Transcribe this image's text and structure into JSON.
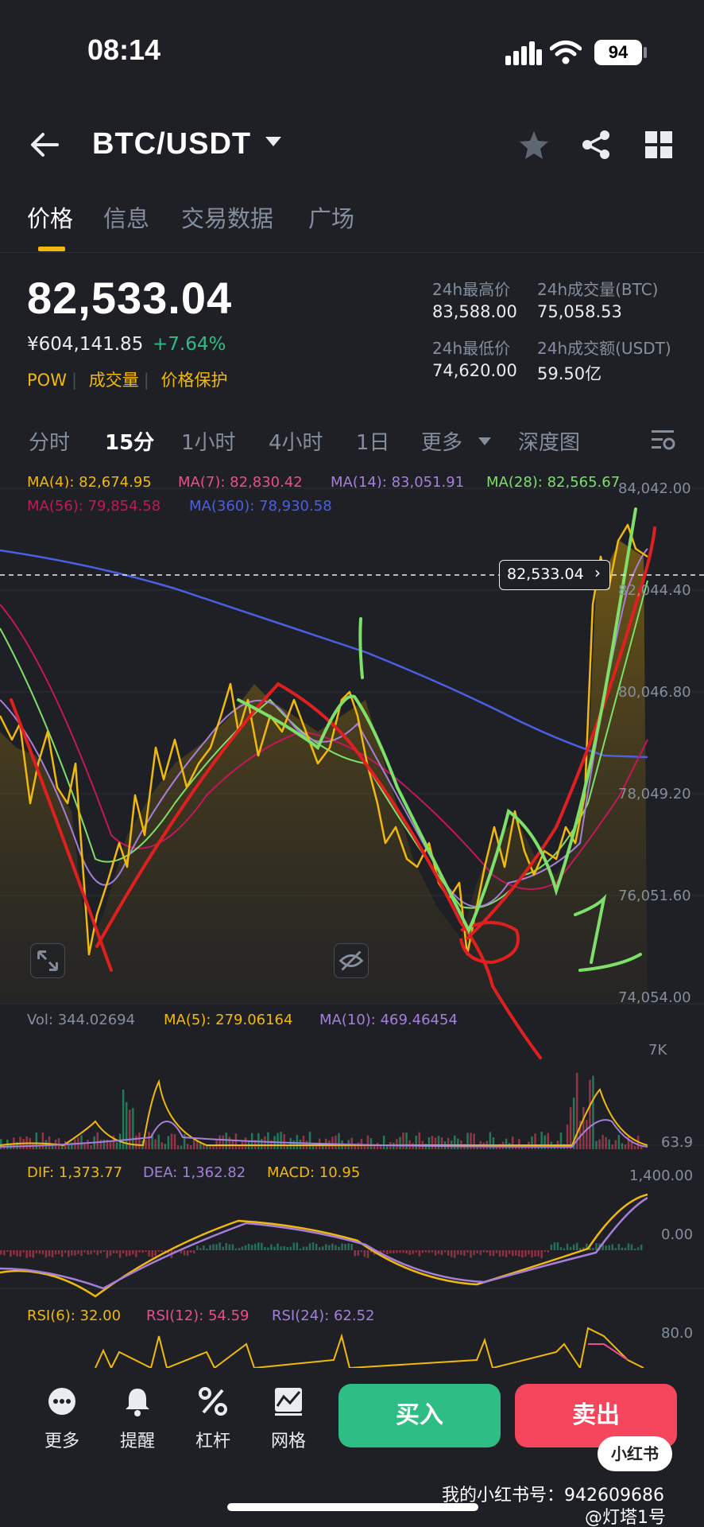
{
  "status_bar": {
    "time": "08:14",
    "battery": "94"
  },
  "header": {
    "pair": "BTC/USDT"
  },
  "tabs": [
    {
      "label": "价格",
      "active": true
    },
    {
      "label": "信息"
    },
    {
      "label": "交易数据"
    },
    {
      "label": "广场"
    }
  ],
  "ticker": {
    "price": "82,533.04",
    "cny": "¥604,141.85",
    "change": "+7.64%",
    "tags": [
      "POW",
      "成交量",
      "价格保护"
    ],
    "high_label": "24h最高价",
    "high": "83,588.00",
    "vol_btc_label": "24h成交量(BTC)",
    "vol_btc": "75,058.53",
    "low_label": "24h最低价",
    "low": "74,620.00",
    "vol_usdt_label": "24h成交额(USDT)",
    "vol_usdt": "59.50亿"
  },
  "intervals": [
    "分时",
    "15分",
    "1小时",
    "4小时",
    "1日",
    "更多",
    "深度图"
  ],
  "active_interval": "15分",
  "ma": {
    "ma4": "MA(4): 82,674.95",
    "ma7": "MA(7): 82,830.42",
    "ma14": "MA(14): 83,051.91",
    "ma28": "MA(28): 82,565.67",
    "ma56": "MA(56): 79,854.58",
    "ma360": "MA(360): 78,930.58"
  },
  "price_axis": [
    "84,042.00",
    "82,044.40",
    "80,046.80",
    "78,049.20",
    "76,051.60",
    "74,054.00"
  ],
  "current_price_tag": "82,533.04",
  "volume": {
    "vol": "Vol: 344.02694",
    "ma5": "MA(5): 279.06164",
    "ma10": "MA(10): 469.46454",
    "axis_top": "7K",
    "axis_bottom": "63.9"
  },
  "macd": {
    "dif": "DIF: 1,373.77",
    "dea": "DEA: 1,362.82",
    "macd": "MACD: 10.95",
    "axis_top": "1,400.00",
    "axis_zero": "0.00"
  },
  "rsi": {
    "rsi6": "RSI(6): 32.00",
    "rsi12": "RSI(12): 54.59",
    "rsi24": "RSI(24): 62.52",
    "axis_top": "80.0"
  },
  "toolbar": {
    "more": "更多",
    "alert": "提醒",
    "leverage": "杠杆",
    "grid": "网格",
    "buy": "买入",
    "sell": "卖出"
  },
  "watermark": {
    "badge": "小红书",
    "id": "我的小红书号：942609686",
    "user": "@灯塔1号"
  },
  "colors": {
    "up": "#2ebd85",
    "down": "#f6465d",
    "accent": "#f0b90b",
    "ma4": "#f0b90b",
    "ma7": "#e84f8e",
    "ma14": "#a57fd9",
    "ma28": "#7ee06a",
    "ma56": "#c2185b",
    "ma360": "#4b5fe0"
  },
  "icons": [
    "back-arrow-icon",
    "caret-down-icon",
    "star-icon",
    "share-icon",
    "grid-icon",
    "chart-settings-icon",
    "expand-icon",
    "hide-icon",
    "more-dots-icon",
    "bell-icon",
    "percent-icon",
    "grid-bot-icon"
  ]
}
